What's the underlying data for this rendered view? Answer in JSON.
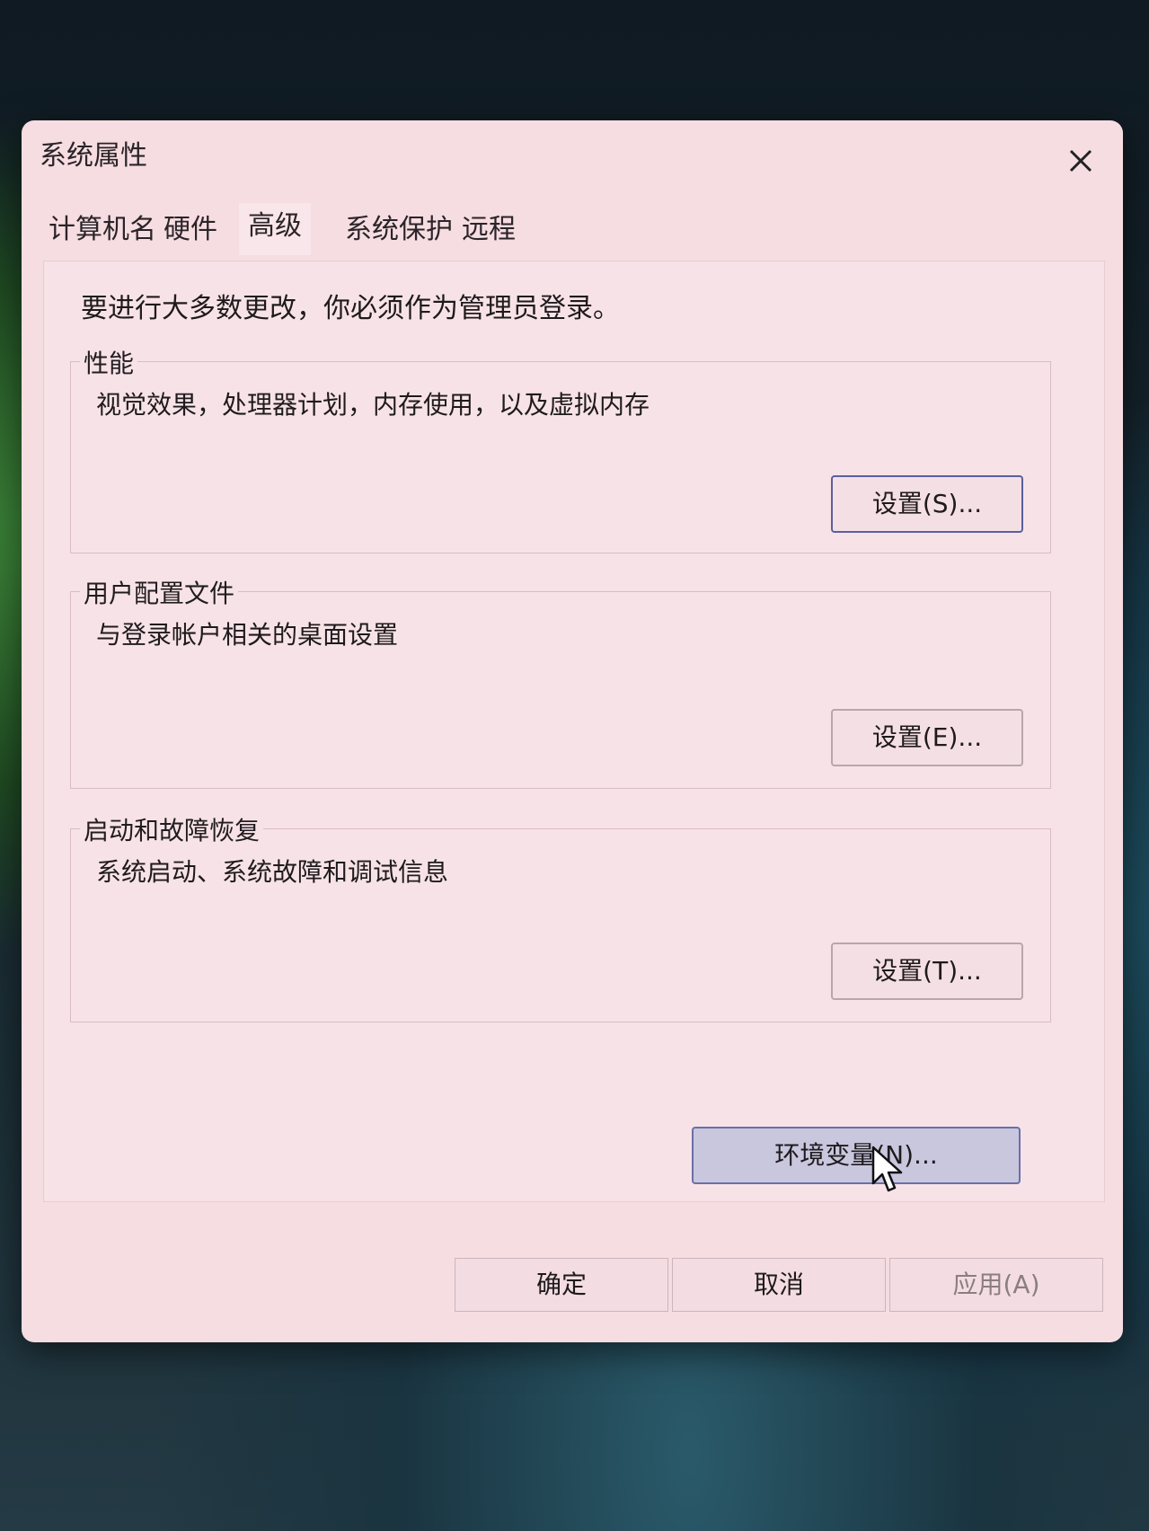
{
  "window": {
    "title": "系统属性"
  },
  "tabs": [
    {
      "label": "计算机名"
    },
    {
      "label": "硬件"
    },
    {
      "label": "高级"
    },
    {
      "label": "系统保护"
    },
    {
      "label": "远程"
    }
  ],
  "active_tab": "高级",
  "note": "要进行大多数更改，你必须作为管理员登录。",
  "groups": {
    "performance": {
      "label": "性能",
      "description": "视觉效果，处理器计划，内存使用，以及虚拟内存",
      "button": "设置(S)..."
    },
    "user_profile": {
      "label": "用户配置文件",
      "description": "与登录帐户相关的桌面设置",
      "button": "设置(E)..."
    },
    "startup_recovery": {
      "label": "启动和故障恢复",
      "description": "系统启动、系统故障和调试信息",
      "button": "设置(T)..."
    }
  },
  "env_button": "环境变量(N)...",
  "footer": {
    "ok": "确定",
    "cancel": "取消",
    "apply": "应用(A)"
  },
  "icons": {
    "close": "close-icon",
    "cursor": "mouse-pointer-icon"
  }
}
